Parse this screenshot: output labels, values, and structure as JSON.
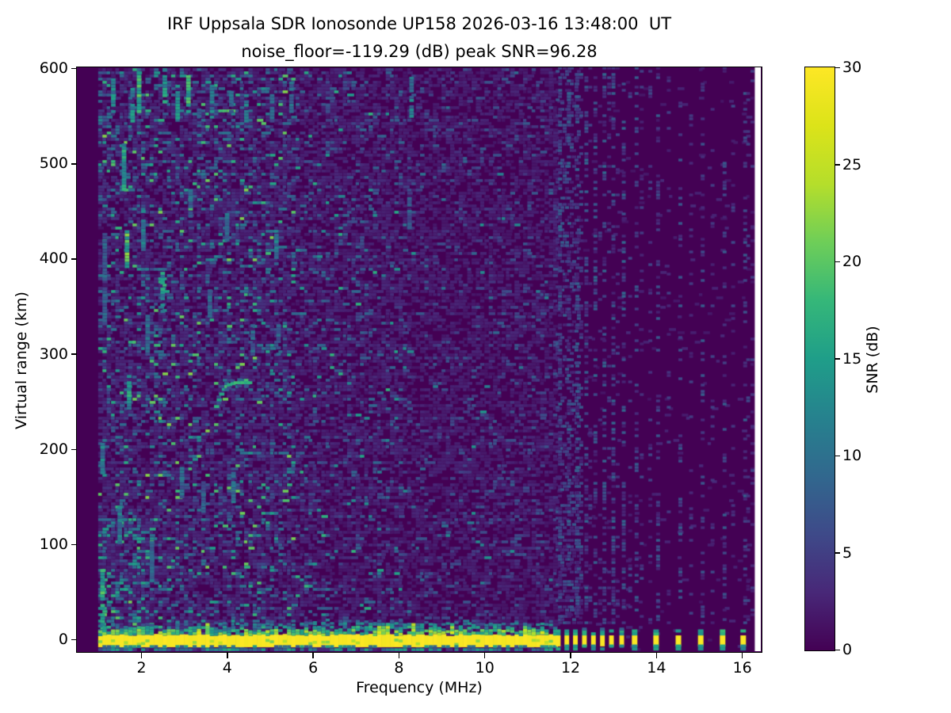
{
  "figure": {
    "title_line1": "IRF Uppsala SDR Ionosonde UP158 2026-03-16 13:48:00  UT",
    "title_line2": "noise_floor=-119.29 (dB) peak SNR=96.28",
    "background": "#ffffff"
  },
  "axes": {
    "xlabel": "Frequency (MHz)",
    "ylabel": "Virtual range (km)",
    "x_ticks": [
      2,
      4,
      6,
      8,
      10,
      12,
      14,
      16
    ],
    "y_ticks": [
      0,
      100,
      200,
      300,
      400,
      500,
      600
    ],
    "xlim": [
      0.504,
      16.44
    ],
    "ylim": [
      -12.5,
      601
    ]
  },
  "colorbar": {
    "label": "SNR (dB)",
    "ticks": [
      0,
      5,
      10,
      15,
      20,
      25,
      30
    ],
    "min": 0,
    "max": 30,
    "colormap": "viridis",
    "stops": [
      "#440154",
      "#482878",
      "#3e4a89",
      "#31688e",
      "#26828e",
      "#1f9e89",
      "#35b779",
      "#6ece58",
      "#b5de2b",
      "#dce319",
      "#fde725"
    ]
  },
  "chart_data": {
    "type": "heatmap",
    "title": "IRF Uppsala SDR Ionosonde UP158 2026-03-16 13:48:00  UT",
    "subtitle": "noise_floor=-119.29 (dB) peak SNR=96.28",
    "xlabel": "Frequency (MHz)",
    "ylabel": "Virtual range (km)",
    "color_label": "SNR (dB)",
    "xlim": [
      0.504,
      16.44
    ],
    "ylim": [
      -12.5,
      601
    ],
    "clim": [
      0,
      30
    ],
    "colormap": "viridis",
    "background_snr": 0,
    "freq_step_mhz": 0.1,
    "range_step_km": 3.33,
    "data_freq_range": [
      1.0,
      16.3
    ],
    "features": {
      "ground_return": {
        "freq_range": [
          1.0,
          11.62
        ],
        "km_range": [
          -7.5,
          4.5
        ],
        "snr": 30,
        "scatter_top_km": 18,
        "underside_km_range": [
          -12.3,
          -8.0
        ]
      },
      "rfi_bars_0p2mhz": [
        11.72,
        11.92,
        12.12,
        12.33,
        12.54,
        12.75,
        12.96,
        13.2
      ],
      "rfi_bars_0p5mhz": [
        13.5,
        14.0,
        14.52,
        15.04,
        15.55,
        16.03
      ],
      "rfi_faint_cluster_range": [
        11.66,
        12.21
      ],
      "rfi_faint_extra_columns": [
        12.42,
        12.65,
        12.86,
        13.06,
        13.35,
        13.62,
        13.82,
        14.25,
        14.77,
        15.27,
        15.75,
        16.1,
        16.2
      ],
      "echo_trace": {
        "snr": 17,
        "points_freq_km": [
          [
            3.7,
            243
          ],
          [
            3.76,
            250
          ],
          [
            3.82,
            256
          ],
          [
            3.88,
            261
          ],
          [
            3.94,
            264
          ],
          [
            4.0,
            266
          ],
          [
            4.08,
            267
          ],
          [
            4.16,
            268
          ],
          [
            4.24,
            268
          ],
          [
            4.32,
            268
          ],
          [
            4.4,
            268
          ],
          [
            4.47,
            268
          ]
        ]
      },
      "noise_streaks_freq_km0_km1_snr": [
        [
          1.05,
          4,
          72,
          18
        ],
        [
          1.05,
          170,
          205,
          12
        ],
        [
          1.1,
          330,
          420,
          9
        ],
        [
          1.3,
          553,
          588,
          14
        ],
        [
          1.45,
          100,
          140,
          12
        ],
        [
          1.55,
          468,
          520,
          16
        ],
        [
          1.62,
          390,
          432,
          20
        ],
        [
          1.67,
          238,
          276,
          16
        ],
        [
          1.75,
          543,
          580,
          14
        ],
        [
          1.9,
          553,
          595,
          18
        ],
        [
          2.0,
          408,
          450,
          12
        ],
        [
          2.1,
          298,
          340,
          10
        ],
        [
          2.2,
          60,
          100,
          10
        ],
        [
          2.45,
          343,
          385,
          15
        ],
        [
          2.5,
          563,
          598,
          16
        ],
        [
          2.8,
          543,
          580,
          14
        ],
        [
          2.9,
          148,
          180,
          10
        ],
        [
          3.05,
          553,
          590,
          18
        ],
        [
          3.1,
          443,
          470,
          10
        ],
        [
          3.3,
          528,
          556,
          9
        ],
        [
          3.4,
          133,
          165,
          9
        ],
        [
          3.55,
          338,
          365,
          10
        ],
        [
          3.6,
          553,
          580,
          12
        ],
        [
          3.95,
          418,
          445,
          10
        ],
        [
          4.05,
          553,
          576,
          10
        ],
        [
          4.1,
          143,
          175,
          10
        ],
        [
          4.4,
          543,
          570,
          12
        ],
        [
          4.55,
          298,
          330,
          10
        ],
        [
          5.0,
          543,
          570,
          9
        ],
        [
          5.1,
          393,
          425,
          12
        ],
        [
          5.15,
          298,
          330,
          9
        ],
        [
          5.45,
          553,
          585,
          10
        ],
        [
          6.3,
          553,
          575,
          8
        ],
        [
          8.2,
          428,
          462,
          8
        ],
        [
          8.25,
          548,
          590,
          12
        ]
      ],
      "noise_density_breaks_mhz": [
        5.5,
        8.0,
        11.62
      ]
    }
  }
}
